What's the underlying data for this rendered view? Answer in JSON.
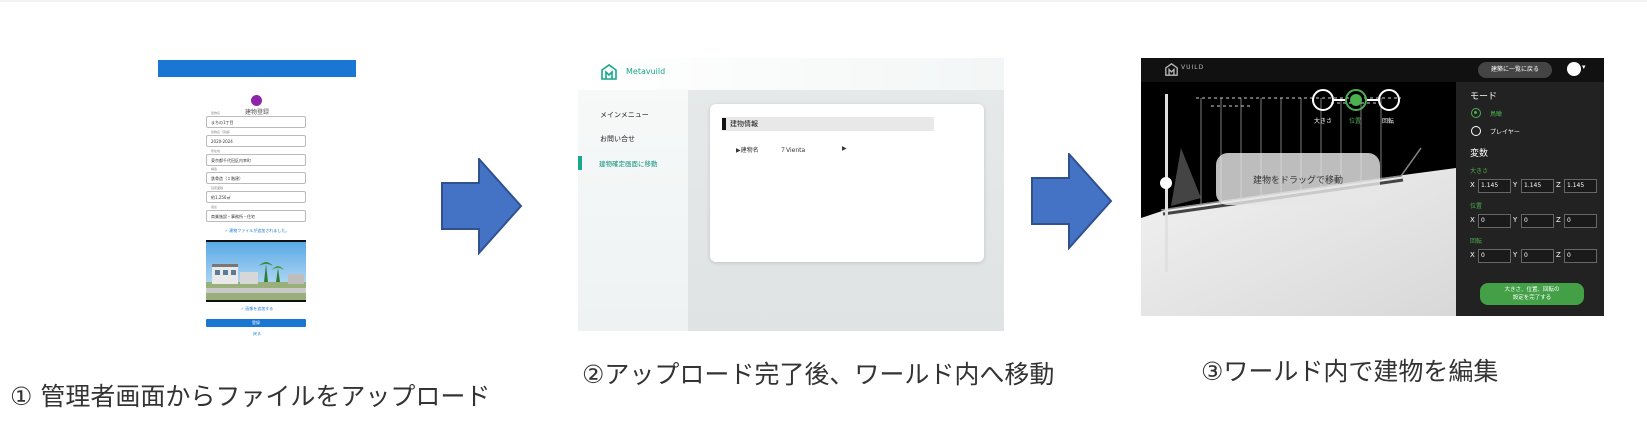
{
  "colors": {
    "arrow_fill": "#4472c4",
    "arrow_stroke": "#2f528f",
    "admin_accent": "#1976d2",
    "metavuild_green": "#17a68c",
    "editor_green": "#4caf50"
  },
  "step1": {
    "caption": "① 管理者画面からファイルをアップロード",
    "screen": {
      "title": "建物登録",
      "fields": [
        {
          "label": "建物名",
          "value": "まちの1丁目"
        },
        {
          "label": "建物名（英語）",
          "value": "2020-2024"
        },
        {
          "label": "所在地",
          "value": "東京都千代田区内幸町"
        },
        {
          "label": "構造",
          "value": "鉄骨造（１階建）"
        },
        {
          "label": "延床面積",
          "value": "約1,250㎡"
        },
        {
          "label": "用途",
          "value": "商業施設・事務所・住宅"
        }
      ],
      "upload_ok_text": "✓ 建物ファイルが追加されました。",
      "image_ok_text": "✓ 画像を追加する",
      "register_button": "登録",
      "back_link": "戻る"
    }
  },
  "step2": {
    "caption": "②アップロード完了後、ワールド内へ移動",
    "screen": {
      "brand": "Metavuild",
      "menu": [
        "メインメニュー",
        "お問い合せ",
        "建物確定画面に移動"
      ],
      "card_title": "建物情報",
      "row_label": "▶建物名",
      "row_value": "７Vienta",
      "row_arrow": "▶"
    }
  },
  "step3": {
    "caption": "③ワールド内で建物を編集",
    "screen": {
      "logo_text": "VUILD",
      "back_button": "建築に一覧に戻る",
      "modes": [
        "大きさ",
        "位置",
        "回転"
      ],
      "drag_hint": "建物をドラッグで移動",
      "panel": {
        "mode_title": "モード",
        "mode_options": [
          "鳥瞰",
          "プレイヤー"
        ],
        "param_title": "変数",
        "size_label": "大きさ",
        "size_values": [
          "1.145",
          "1.145",
          "1.145"
        ],
        "position_label": "位置",
        "position_values": [
          "0",
          "0",
          "0"
        ],
        "rotation_label": "回転",
        "rotation_values": [
          "0",
          "0",
          "0"
        ],
        "axes": [
          "X",
          "Y",
          "Z"
        ],
        "done_button_line1": "大きさ、位置、回転の",
        "done_button_line2": "設定を完了する"
      }
    }
  }
}
